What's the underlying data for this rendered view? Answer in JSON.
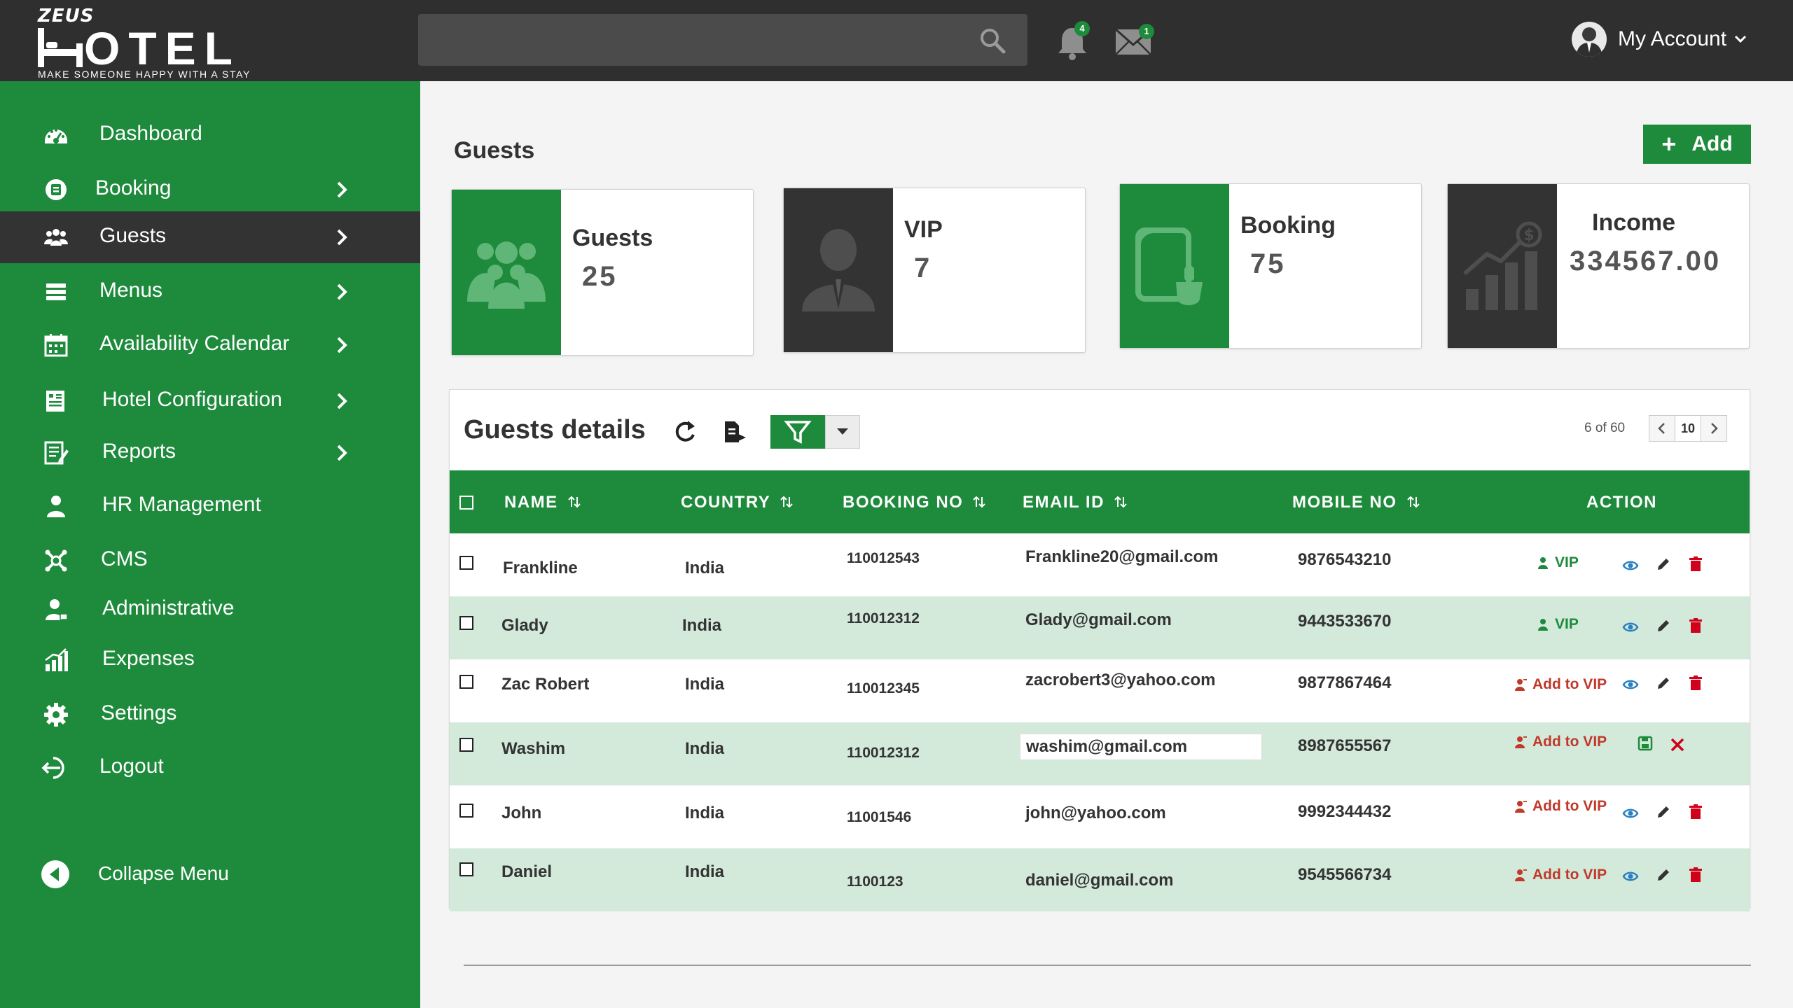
{
  "brand": {
    "zeus": "ZEUS",
    "word": "OTEL",
    "tagline": "MAKE SOMEONE HAPPY WITH A STAY"
  },
  "header": {
    "search_placeholder": "",
    "notifications_count": "4",
    "messages_count": "1",
    "account_label": "My Account"
  },
  "sidebar": {
    "items": [
      {
        "label": "Dashboard",
        "icon": "dashboard-icon"
      },
      {
        "label": "Booking",
        "icon": "booking-icon"
      },
      {
        "label": "Guests",
        "icon": "guests-icon"
      },
      {
        "label": "Menus",
        "icon": "menus-icon"
      },
      {
        "label": "Availability Calendar",
        "icon": "calendar-icon"
      },
      {
        "label": "Hotel Configuration",
        "icon": "hotel-config-icon"
      },
      {
        "label": "Reports",
        "icon": "reports-icon"
      },
      {
        "label": "HR Management",
        "icon": "hr-icon"
      },
      {
        "label": "CMS",
        "icon": "cms-icon"
      },
      {
        "label": "Administrative",
        "icon": "admin-icon"
      },
      {
        "label": "Expenses",
        "icon": "expenses-icon"
      },
      {
        "label": "Settings",
        "icon": "gear-icon"
      },
      {
        "label": "Logout",
        "icon": "logout-icon"
      }
    ],
    "collapse_label": "Collapse Menu",
    "active": "Guests"
  },
  "main": {
    "title": "Guests",
    "add_label": "Add",
    "cards": [
      {
        "title": "Guests",
        "value": "25"
      },
      {
        "title": "VIP",
        "value": "7"
      },
      {
        "title": "Booking",
        "value": "75"
      },
      {
        "title": "Income",
        "value": "334567.00"
      }
    ]
  },
  "table": {
    "title": "Guests details",
    "pager_text": "6 of 60",
    "page_size": "10",
    "columns": [
      "NAME",
      "COUNTRY",
      "BOOKING NO",
      "EMAIL ID",
      "MOBILE NO",
      "ACTION"
    ],
    "vip_label": "VIP",
    "add_vip_label": "Add to VIP",
    "rows": [
      {
        "name": "Frankline",
        "country": "India",
        "booking": "110012543",
        "email": "Frankline20@gmail.com",
        "mobile": "9876543210",
        "status": "vip"
      },
      {
        "name": "Glady",
        "country": "India",
        "booking": "110012312",
        "email": "Glady@gmail.com",
        "mobile": "9443533670",
        "status": "vip"
      },
      {
        "name": "Zac Robert",
        "country": "India",
        "booking": "110012345",
        "email": "zacrobert3@yahoo.com",
        "mobile": "9877867464",
        "status": "add"
      },
      {
        "name": "Washim",
        "country": "India",
        "booking": "110012312",
        "email": "washim@gmail.com",
        "mobile": "8987655567",
        "status": "add",
        "editing": true
      },
      {
        "name": "John",
        "country": "India",
        "booking": "11001546",
        "email": "john@yahoo.com",
        "mobile": "9992344432",
        "status": "add"
      },
      {
        "name": "Daniel",
        "country": "India",
        "booking": "1100123",
        "email": "daniel@gmail.com",
        "mobile": "9545566734",
        "status": "add"
      }
    ]
  },
  "colors": {
    "brand_green": "#1e8a3c",
    "dark": "#2f2f2f",
    "row_alt": "#d3eadb",
    "delete_red": "#d0021b",
    "view_blue": "#2a7fc1"
  }
}
